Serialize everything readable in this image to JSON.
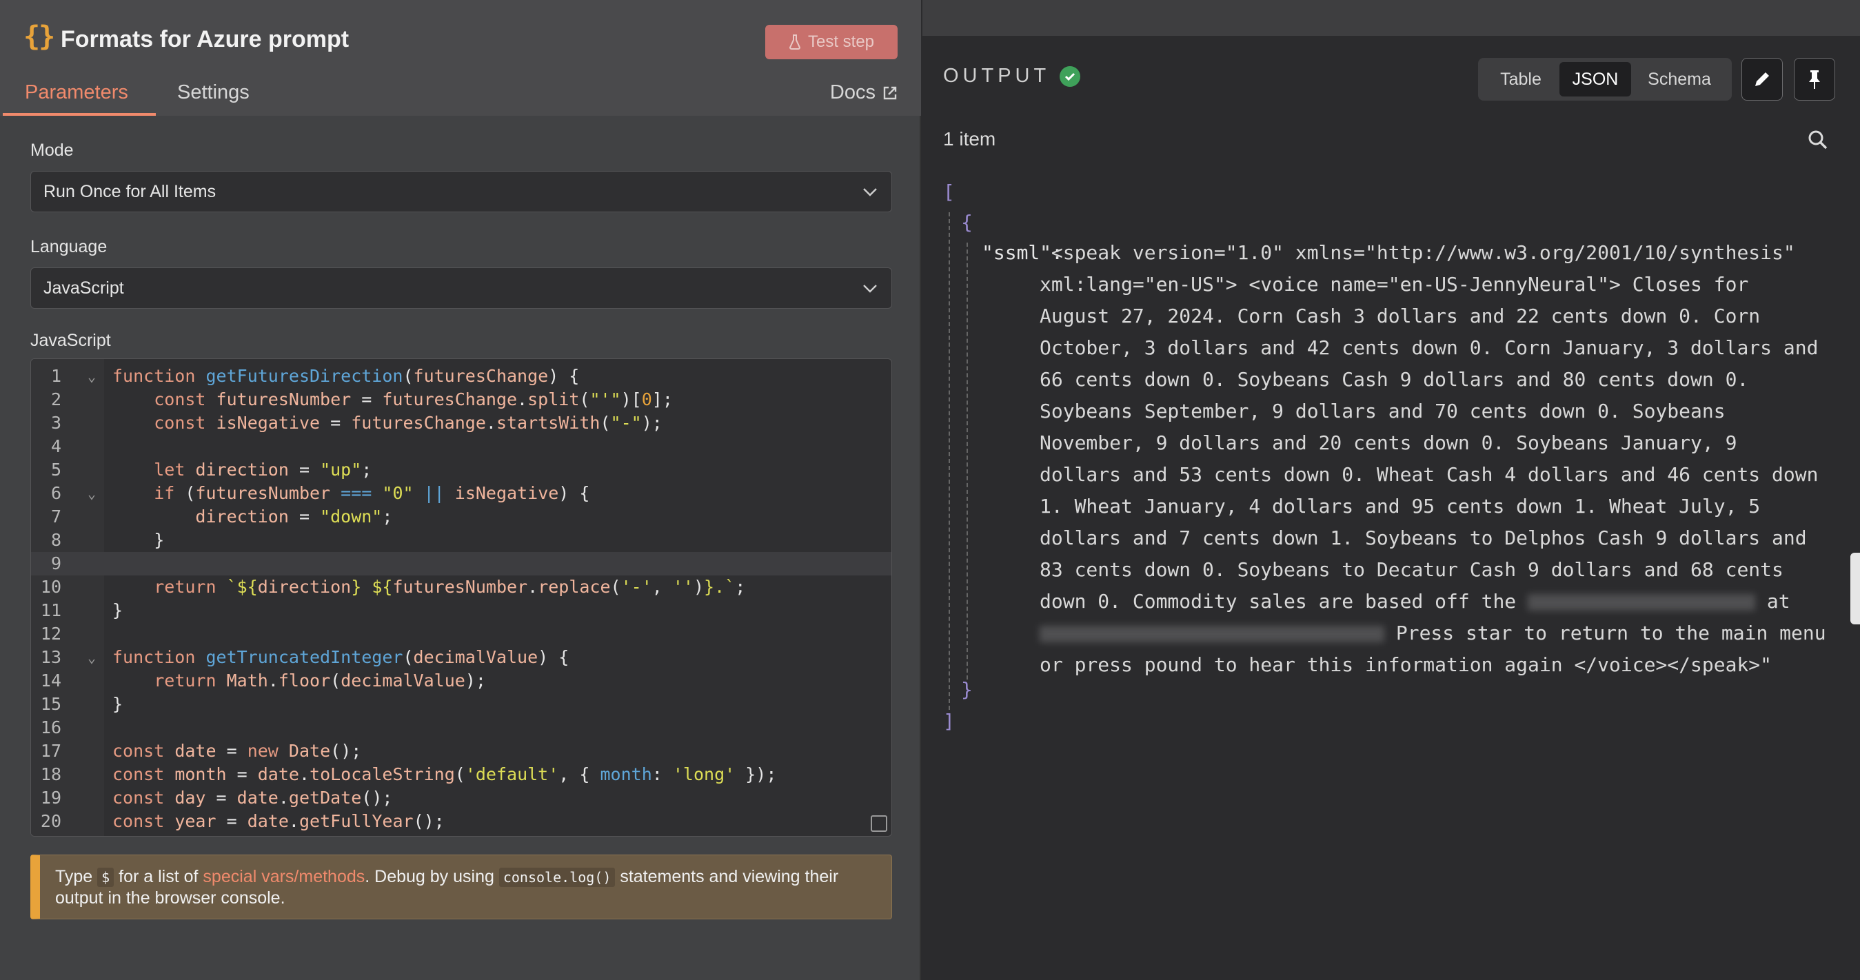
{
  "node": {
    "icon": "braces-icon",
    "title": "Formats for Azure prompt",
    "test_step_label": "Test step"
  },
  "tabs": {
    "parameters": "Parameters",
    "settings": "Settings",
    "docs": "Docs"
  },
  "mode": {
    "label": "Mode",
    "value": "Run Once for All Items"
  },
  "language": {
    "label": "Language",
    "value": "JavaScript"
  },
  "editor": {
    "label": "JavaScript"
  },
  "hint": {
    "prefix": "Type ",
    "dollar": "$",
    "middle": " for a list of ",
    "link": "special vars/methods",
    "after_link": ". Debug by using ",
    "code": "console.log()",
    "suffix": " statements and viewing their output in the browser console."
  },
  "output": {
    "title": "OUTPUT",
    "views": [
      "Table",
      "JSON",
      "Schema"
    ],
    "selected_view": "JSON",
    "item_count": "1 item",
    "json_key": "\"ssml\":",
    "json_lines": [
      "\"<speak version=\"1.0\" xmlns=\"http://www.w3.org/2001/10/synthesis\"",
      "xml:lang=\"en-US\"> <voice name=\"en-US-JennyNeural\"> Closes for",
      "August 27, 2024. Corn Cash 3 dollars and 22 cents down 0. Corn",
      "October, 3 dollars and 42 cents down 0. Corn January, 3 dollars and",
      "66 cents down 0. Soybeans Cash 9 dollars and 80 cents down 0.",
      "Soybeans September, 9 dollars and 70 cents down 0. Soybeans",
      "November, 9 dollars and 20 cents down 0. Soybeans January, 9",
      "dollars and 53 cents down 0. Wheat Cash 4 dollars and 46 cents down",
      "1. Wheat January, 4 dollars and 95 cents down 1. Wheat July, 5",
      "dollars and 7 cents down 1. Soybeans to Delphos Cash 9 dollars and",
      "83 cents down 0. Soybeans to Decatur Cash 9 dollars and 68 cents",
      "down 0. Commodity sales are based off the",
      " Press star to return to the main menu",
      "or press pound to hear this information again </voice></speak>\""
    ],
    "line_12_tail": " at"
  }
}
